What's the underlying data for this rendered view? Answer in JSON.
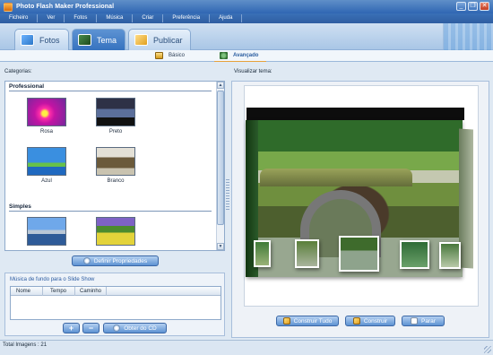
{
  "window": {
    "title": "Photo Flash Maker Professional",
    "minimize": "_",
    "restore": "❐",
    "close": "✕"
  },
  "menu": [
    "Ficheiro",
    "Ver",
    "Fotos",
    "Música",
    "Criar",
    "Preferência",
    "Ajuda"
  ],
  "tabs": [
    {
      "label": "Fotos",
      "icon": "photos-icon"
    },
    {
      "label": "Tema",
      "icon": "theme-icon"
    },
    {
      "label": "Publicar",
      "icon": "publish-icon"
    }
  ],
  "subtabs": {
    "basico": "Básico",
    "avancado": "Avançado"
  },
  "left": {
    "categories_label": "Categorias:",
    "groups": {
      "professional": "Professional",
      "simples": "Simples"
    },
    "themes": {
      "rosa": "Rosa",
      "preto": "Preto",
      "azul": "Azul",
      "branco": "Branco"
    },
    "define_props_button": "Definir Propriedades",
    "music": {
      "title": "Música de fundo para o Slide Show",
      "columns": [
        "Nome",
        "Tempo",
        "Caminho"
      ],
      "add_button": "+",
      "remove_button": "−",
      "obter_button": "Obter do CD"
    }
  },
  "right": {
    "preview_label": "Visualizar tema:",
    "build_all_button": "Construir Tudo",
    "build_button": "Construir",
    "stop_button": "Parar"
  },
  "status": {
    "total_images": "Total Imagens : 21"
  },
  "colors": {
    "accent": "#3672bf",
    "menu": "#2f5ea1",
    "titlebar": "#2f66b3"
  }
}
